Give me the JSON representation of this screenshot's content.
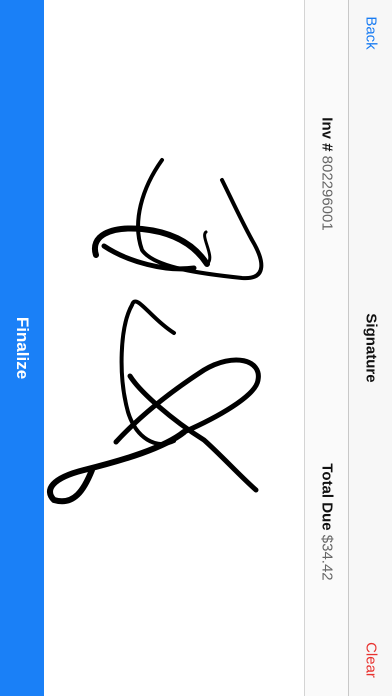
{
  "finalize": {
    "label": "Finalize"
  },
  "nav": {
    "back_label": "Back",
    "title": "Signature",
    "clear_label": "Clear"
  },
  "invoice": {
    "number_label": "Inv #",
    "number_value": "802296001",
    "total_label": "Total Due",
    "total_value": "$34.42"
  },
  "colors": {
    "accent": "#1a80f7",
    "destructive": "#e8322f",
    "ink": "#000000"
  }
}
